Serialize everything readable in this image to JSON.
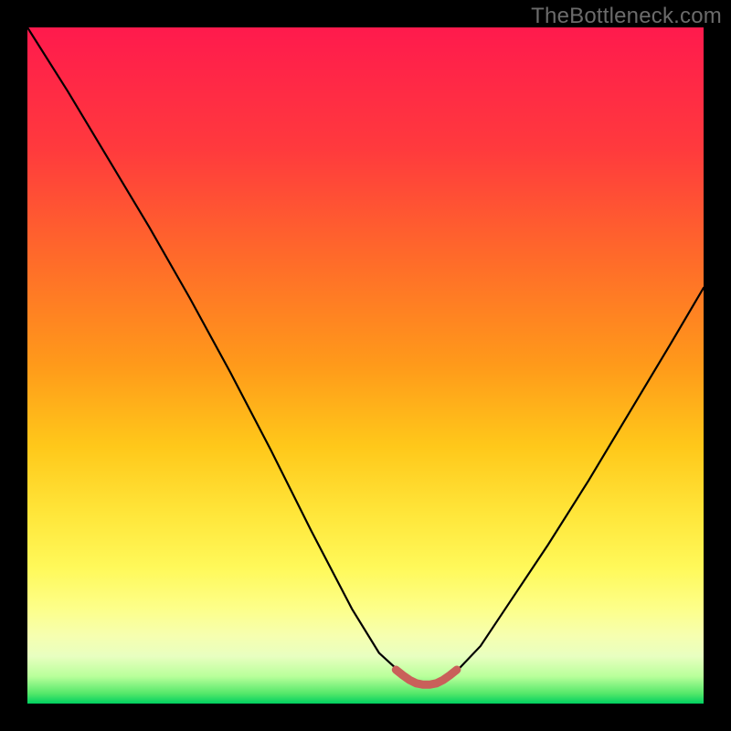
{
  "watermark": "TheBottleneck.com",
  "chart_data": {
    "type": "line",
    "title": "",
    "xlabel": "",
    "ylabel": "",
    "xlim": [
      0,
      1
    ],
    "ylim": [
      0,
      1
    ],
    "grid": false,
    "legend": false,
    "series": [
      {
        "name": "main-curve",
        "color": "#000000",
        "x": [
          0.0,
          0.06,
          0.12,
          0.18,
          0.24,
          0.3,
          0.36,
          0.42,
          0.48,
          0.52,
          0.555,
          0.58,
          0.605,
          0.63,
          0.67,
          0.71,
          0.77,
          0.83,
          0.89,
          0.95,
          1.0
        ],
        "values": [
          1.0,
          0.905,
          0.805,
          0.705,
          0.6,
          0.49,
          0.375,
          0.255,
          0.14,
          0.075,
          0.043,
          0.03,
          0.03,
          0.043,
          0.085,
          0.145,
          0.235,
          0.33,
          0.43,
          0.53,
          0.615
        ]
      },
      {
        "name": "flat-bottom-highlight",
        "color": "#c9605a",
        "x": [
          0.545,
          0.555,
          0.565,
          0.575,
          0.585,
          0.595,
          0.605,
          0.615,
          0.625,
          0.635
        ],
        "values": [
          0.05,
          0.042,
          0.035,
          0.03,
          0.028,
          0.028,
          0.03,
          0.035,
          0.042,
          0.05
        ]
      }
    ],
    "background_gradient_stops": [
      {
        "pos": 0.0,
        "color": "#ff1a4d"
      },
      {
        "pos": 0.5,
        "color": "#ff9a1a"
      },
      {
        "pos": 0.8,
        "color": "#fff95a"
      },
      {
        "pos": 0.93,
        "color": "#e8ffc0"
      },
      {
        "pos": 1.0,
        "color": "#00d060"
      }
    ]
  }
}
